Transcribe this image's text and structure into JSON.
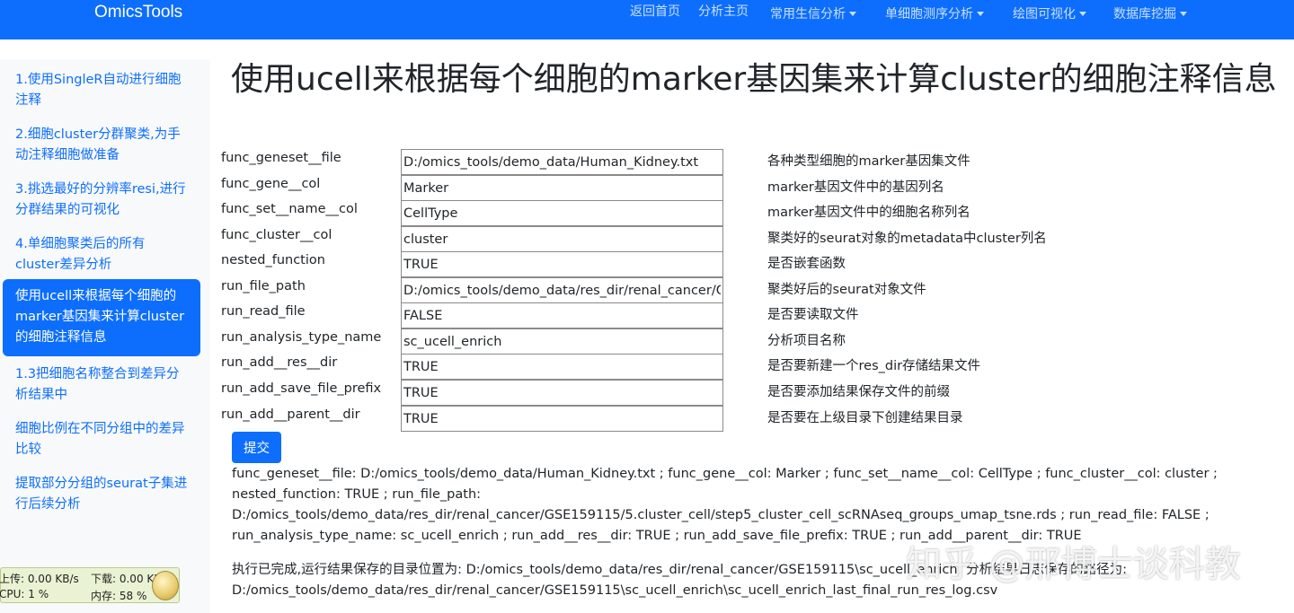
{
  "navbar": {
    "brand": "OmicsTools",
    "items": [
      {
        "label": "返回首页",
        "dropdown": false
      },
      {
        "label": "分析主页",
        "dropdown": false
      },
      {
        "label": "常用生信分析",
        "dropdown": true
      },
      {
        "label": "单细胞测序分析",
        "dropdown": true
      },
      {
        "label": "绘图可视化",
        "dropdown": true
      },
      {
        "label": "数据库挖掘",
        "dropdown": true
      }
    ]
  },
  "sidebar": {
    "items": [
      {
        "label": "1.使用SingleR自动进行细胞注释",
        "active": false
      },
      {
        "label": "2.细胞cluster分群聚类,为手动注释细胞做准备",
        "active": false
      },
      {
        "label": "3.挑选最好的分辨率resi,进行分群结果的可视化",
        "active": false
      },
      {
        "label": "4.单细胞聚类后的所有cluster差异分析",
        "active": false
      },
      {
        "label": "使用ucell来根据每个细胞的marker基因集来计算cluster的细胞注释信息",
        "active": true
      },
      {
        "label": "1.3把细胞名称整合到差异分析结果中",
        "active": false
      },
      {
        "label": "细胞比例在不同分组中的差异比较",
        "active": false
      },
      {
        "label": "提取部分分组的seurat子集进行后续分析",
        "active": false
      }
    ]
  },
  "main": {
    "title": "使用ucell来根据每个细胞的marker基因集来计算cluster的细胞注释信息",
    "fields": [
      {
        "label": "func_geneset__file",
        "value": "D:/omics_tools/demo_data/Human_Kidney.txt",
        "description": "各种类型细胞的marker基因集文件"
      },
      {
        "label": "func_gene__col",
        "value": "Marker",
        "description": "marker基因文件中的基因列名"
      },
      {
        "label": "func_set__name__col",
        "value": "CellType",
        "description": "marker基因文件中的细胞名称列名"
      },
      {
        "label": "func_cluster__col",
        "value": "cluster",
        "description": "聚类好的seurat对象的metadata中cluster列名"
      },
      {
        "label": "nested_function",
        "value": "TRUE",
        "description": "是否嵌套函数"
      },
      {
        "label": "run_file_path",
        "value": "D:/omics_tools/demo_data/res_dir/renal_cancer/GSE159115/5.cluster_cell/step5_cluster_cell_scRNAseq_groups_umap_tsne.rds",
        "description": "聚类好后的seurat对象文件"
      },
      {
        "label": "run_read_file",
        "value": "FALSE",
        "description": "是否要读取文件"
      },
      {
        "label": "run_analysis_type_name",
        "value": "sc_ucell_enrich",
        "description": "分析项目名称"
      },
      {
        "label": "run_add__res__dir",
        "value": "TRUE",
        "description": "是否要新建一个res_dir存储结果文件"
      },
      {
        "label": "run_add_save_file_prefix",
        "value": "TRUE",
        "description": "是否要添加结果保存文件的前缀"
      },
      {
        "label": "run_add__parent__dir",
        "value": "TRUE",
        "description": "是否要在上级目录下创建结果目录"
      }
    ],
    "submit_label": "提交",
    "summary": "func_geneset__file: D:/omics_tools/demo_data/Human_Kidney.txt ; func_gene__col: Marker ; func_set__name__col: CellType ; func_cluster__col: cluster ; nested_function: TRUE ; run_file_path: D:/omics_tools/demo_data/res_dir/renal_cancer/GSE159115/5.cluster_cell/step5_cluster_cell_scRNAseq_groups_umap_tsne.rds ; run_read_file: FALSE ; run_analysis_type_name: sc_ucell_enrich ; run_add__res__dir: TRUE ; run_add_save_file_prefix: TRUE ; run_add__parent__dir: TRUE",
    "result": "执行已完成,运行结果保存的目录位置为: D:/omics_tools/demo_data/res_dir/renal_cancer/GSE159115\\sc_ucell_enrich; 分析结果日志保存的路径为: D:/omics_tools/demo_data/res_dir/renal_cancer/GSE159115\\sc_ucell_enrich\\sc_ucell_enrich_last_final_run_res_log.csv"
  },
  "monitor": {
    "upload": "上传: 0.00 KB/s",
    "download": "下载: 0.00 KB/s",
    "cpu": "CPU: 1 %",
    "memory": "内存: 58 %"
  },
  "watermark": "知乎 @邢博士谈科教",
  "colors": {
    "primary": "#0d6efd",
    "sidebar_bg": "#f8f9fa"
  }
}
